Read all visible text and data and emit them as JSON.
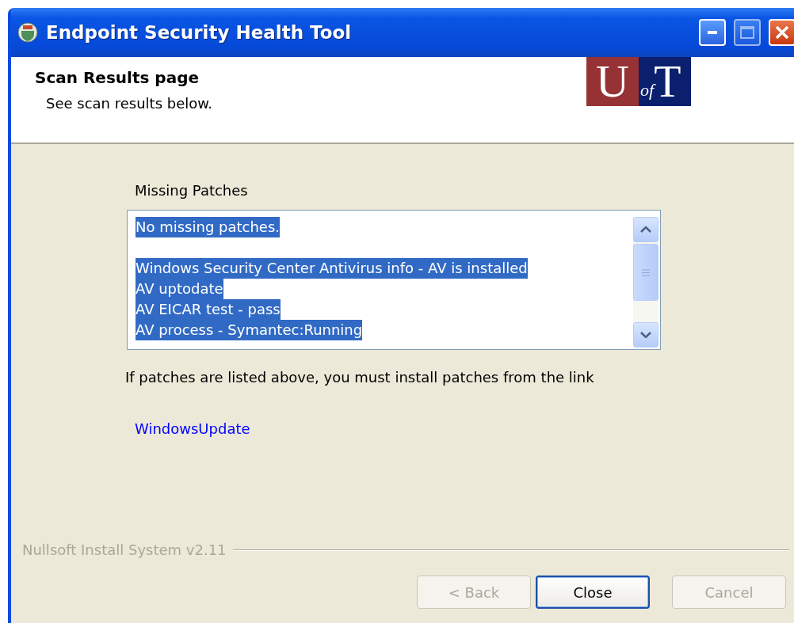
{
  "window": {
    "title": "Endpoint Security Health Tool"
  },
  "header": {
    "title": "Scan Results page",
    "subtitle": "See scan results below.",
    "logo": {
      "letter_left": "U",
      "middle": "of",
      "letter_right": "T"
    }
  },
  "patches": {
    "label": "Missing Patches",
    "lines": [
      {
        "kind": "text",
        "text": "No missing patches.",
        "selected": true
      },
      {
        "kind": "blank"
      },
      {
        "kind": "text",
        "text": "Windows Security Center Antivirus info - AV is installed",
        "selected": true
      },
      {
        "kind": "text",
        "text": "AV uptodate",
        "selected": true
      },
      {
        "kind": "text",
        "text": "AV EICAR test - pass",
        "selected": true
      },
      {
        "kind": "text",
        "text": "AV process - Symantec:Running",
        "selected": true
      }
    ]
  },
  "note": "If patches are listed above, you must install patches from the link",
  "link": "WindowsUpdate",
  "footer": {
    "brand": "Nullsoft Install System v2.11"
  },
  "buttons": [
    {
      "label": "< Back",
      "disabled": true,
      "default": false
    },
    {
      "label": "Close",
      "disabled": false,
      "default": true
    },
    {
      "label": "Cancel",
      "disabled": true,
      "default": false
    }
  ]
}
